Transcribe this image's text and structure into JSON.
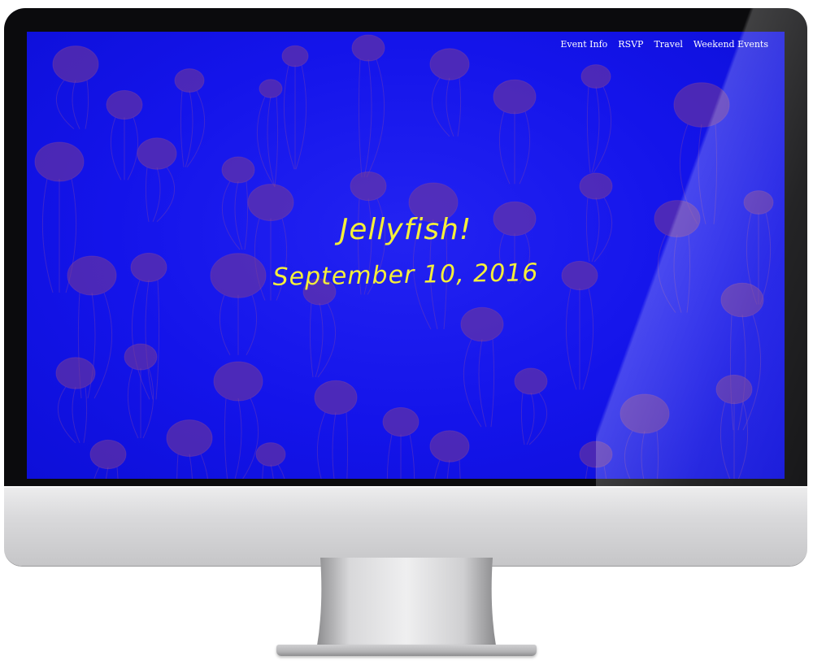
{
  "site": {
    "nav": [
      {
        "label": "Event Info"
      },
      {
        "label": "RSVP"
      },
      {
        "label": "Travel"
      },
      {
        "label": "Weekend Events"
      }
    ],
    "hero": {
      "title": "Jellyfish!",
      "date": "September 10, 2016"
    }
  },
  "colors": {
    "background": "#1616e8",
    "accent_text": "#f5ef3a",
    "nav_text": "#ffffff",
    "jellyfish": "#7a3a8f"
  },
  "device": {
    "type": "desktop-monitor-mockup"
  }
}
